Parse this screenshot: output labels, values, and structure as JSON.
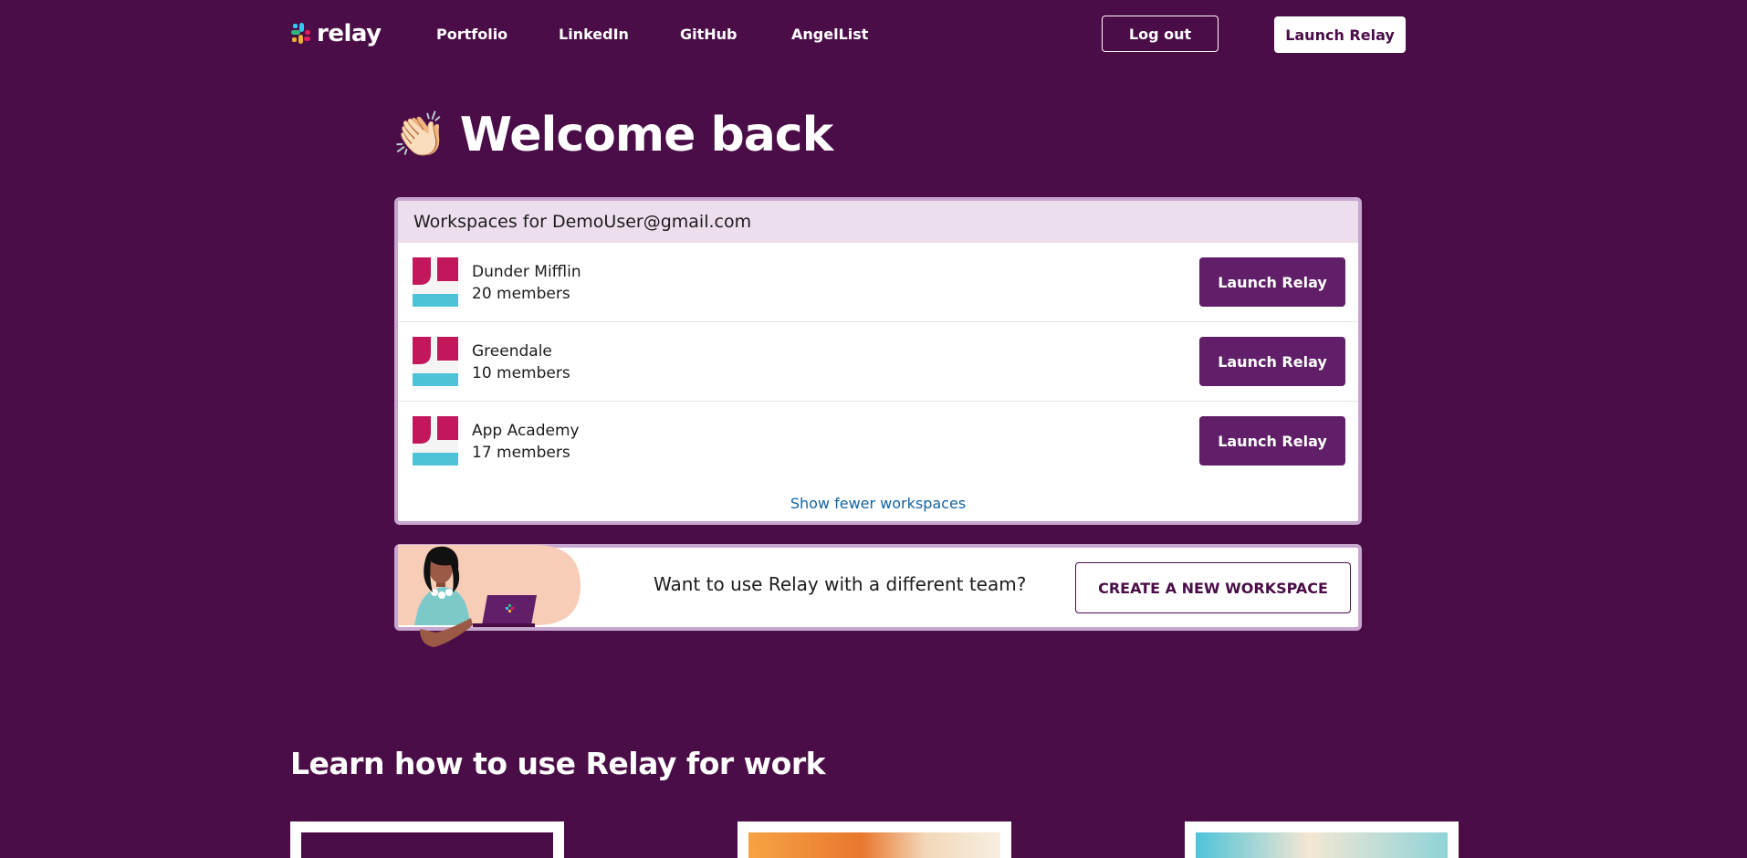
{
  "nav": {
    "brand": "relay",
    "links": [
      "Portfolio",
      "LinkedIn",
      "GitHub",
      "AngelList"
    ],
    "logout_label": "Log out",
    "launch_label": "Launch Relay"
  },
  "hero": {
    "emoji": "👏🏻",
    "title": "Welcome back"
  },
  "workspaces": {
    "header": "Workspaces for DemoUser@gmail.com",
    "items": [
      {
        "name": "Dunder Mifflin",
        "members": "20 members",
        "button": "Launch Relay"
      },
      {
        "name": "Greendale",
        "members": "10 members",
        "button": "Launch Relay"
      },
      {
        "name": "App Academy",
        "members": "17 members",
        "button": "Launch Relay"
      }
    ],
    "toggle_label": "Show fewer workspaces"
  },
  "promo": {
    "text": "Want to use Relay with a different team?",
    "button": "CREATE A NEW WORKSPACE"
  },
  "learn": {
    "title": "Learn how to use Relay for work"
  },
  "colors": {
    "background": "#4a0d47",
    "button_purple": "#611f69",
    "card_border": "#c7a6cf",
    "card_header": "#ecdeec",
    "link_blue": "#1264a3"
  }
}
